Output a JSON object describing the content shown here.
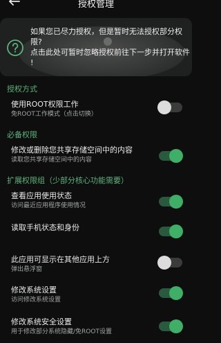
{
  "header": {
    "title": "授权管理"
  },
  "notice": {
    "line1": "如果您已尽力授权，但是暂时无法授权部分权",
    "line2": "限?",
    "line3": "点击此处可暂时忽略授权前往下一步并打开软件",
    "line4": "!"
  },
  "sections": {
    "auth_mode": "授权方式",
    "required": "必备权限",
    "extended": "扩展权限组（少部分核心功能需要）"
  },
  "rows": {
    "root": {
      "title": "使用ROOT权限工作",
      "subtitle": "免ROOT工作模式（点击切换）",
      "enabled": false
    },
    "storage": {
      "title": "修改或删除您共享存储空间中的内容",
      "subtitle": "读取您共享存储空间中的内容",
      "enabled": true
    },
    "usage": {
      "title": "查看应用使用状态",
      "subtitle": "访问最近应用程序使用情况",
      "enabled": true
    },
    "phone": {
      "title": "读取手机状态和身份",
      "subtitle": "",
      "enabled": true
    },
    "overlay": {
      "title": "此应用可显示在其他应用上方",
      "subtitle": "弹出悬浮窗",
      "enabled": false
    },
    "system": {
      "title": "修改系统设置",
      "subtitle": "访问修改系统设置",
      "enabled": true
    },
    "secure": {
      "title": "修改系统安全设置",
      "subtitle": "用于修改部分系统隐藏/免ROOT设置",
      "enabled": true
    }
  },
  "colors": {
    "accent": "#3fae66",
    "section": "#5db37e",
    "background": "#0d0e0d"
  },
  "icons": {
    "back": "back-arrow-icon",
    "help": "help-circle-icon"
  }
}
